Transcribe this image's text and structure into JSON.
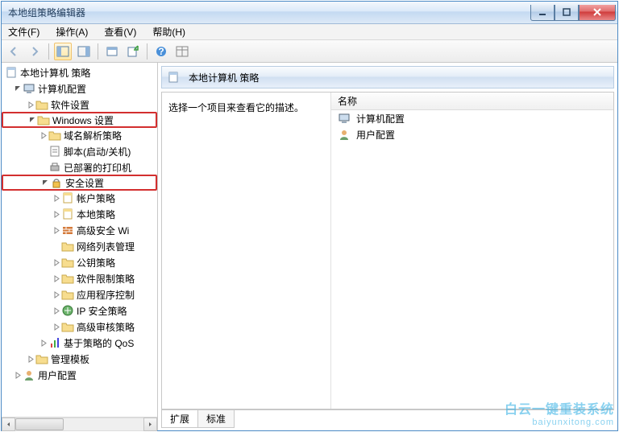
{
  "window": {
    "title": "本地组策略编辑器"
  },
  "menu": {
    "file": "文件(F)",
    "action": "操作(A)",
    "view": "查看(V)",
    "help": "帮助(H)"
  },
  "tree": {
    "root": "本地计算机 策略",
    "computer_config": "计算机配置",
    "software_settings": "软件设置",
    "windows_settings": "Windows 设置",
    "name_resolution": "域名解析策略",
    "scripts": "脚本(启动/关机)",
    "deployed_printers": "已部署的打印机",
    "security_settings": "安全设置",
    "account_policies": "帐户策略",
    "local_policies": "本地策略",
    "advanced_firewall": "高级安全 Wi",
    "network_list": "网络列表管理",
    "public_key": "公钥策略",
    "software_restriction": "软件限制策略",
    "app_control": "应用程序控制",
    "ip_security": "IP 安全策略",
    "advanced_audit": "高级审核策略",
    "qos": "基于策略的 QoS",
    "admin_templates": "管理模板",
    "user_config": "用户配置"
  },
  "right": {
    "path": "本地计算机 策略",
    "placeholder": "选择一个项目来查看它的描述。",
    "col_name": "名称",
    "item_computer": "计算机配置",
    "item_user": "用户配置",
    "tab_ext": "扩展",
    "tab_std": "标准"
  },
  "watermark": {
    "line1": "白云一键重装系统",
    "line2": "baiyunxitong.com"
  }
}
